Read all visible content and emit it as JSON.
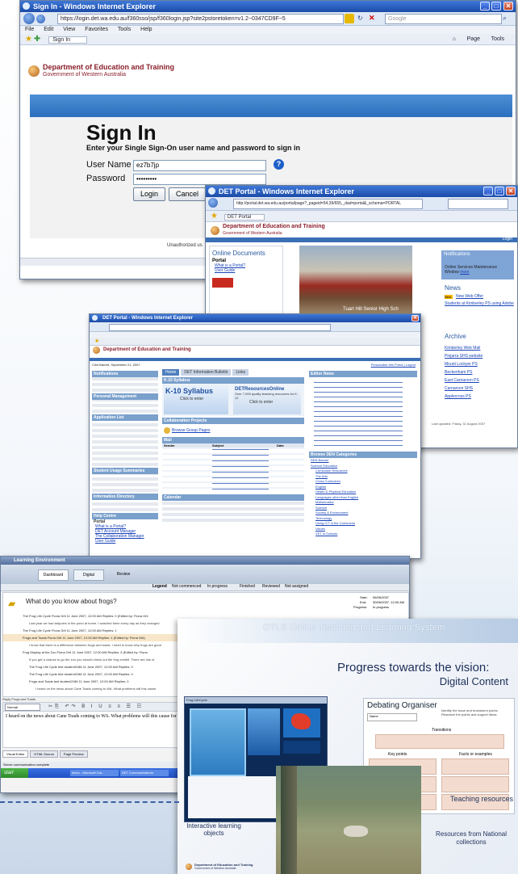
{
  "signin": {
    "title": "Sign In - Windows Internet Explorer",
    "url": "https://login.det.wa.edu.au/f360sso/jsp/f360login.jsp?site2pstoretoken=v1.2~0347CD9F~5",
    "search_placeholder": "Google",
    "menu": [
      "File",
      "Edit",
      "View",
      "Favorites",
      "Tools",
      "Help"
    ],
    "tab": "Sign In",
    "tools": [
      "Page",
      "Tools"
    ],
    "dept_line1": "Department of Education and Training",
    "dept_line2": "Government of Western Australia",
    "heading": "Sign In",
    "subheading": "Enter your Single Sign-On user name and password to sign in",
    "username_label": "User Name",
    "username_value": "ez7b7jp",
    "password_label": "Password",
    "password_value": "•••••••••",
    "login_btn": "Login",
    "cancel_btn": "Cancel",
    "footer": "Unauthorized us"
  },
  "portal": {
    "title": "DET Portal - Windows Internet Explorer",
    "url": "http://portal.det.wa.edu.au/portal/page?_pageid=54,39/655,_dad=portal&_schema=PORTAL",
    "tab": "DET Portal",
    "dept_line1": "Department of Education and Training",
    "dept_line2": "Government of Western Australia",
    "login": "Login",
    "online_docs": "Online Documents",
    "portal_label": "Portal",
    "docs": [
      "What is a Portal?",
      "User Guide"
    ],
    "photo_caption": "Tuart Hill Senior High Sch",
    "notifications": "Notifications",
    "notif_text": "Online Services Maintenance Window",
    "more": "more",
    "news": "News",
    "new_badge": "New",
    "news_item1": "New Web Offer",
    "news_item2": "Students at Kimberley PS using Adobe",
    "archive": "Archive",
    "archive_items": [
      "Kimberley Web Mail",
      "Pinjarra SHS website",
      "Mount Lockyer PS",
      "Beckenham PS",
      "East Carnarvon PS",
      "Carnarvon SHS",
      "Applecross PS"
    ],
    "updated": "Last updated: Friday, 31 August 2007"
  },
  "portal2": {
    "title": "DET Portal - Windows Internet Explorer",
    "user": "Clint Barrett, September 21, 2007",
    "personalise": "Personalise this Portal | Logout",
    "tabs": [
      "Home",
      "DET Information Bulletin",
      "Links"
    ],
    "k10_title": "K-10 Syllabus",
    "k10_logo": "K-10 Syllabus",
    "det_res_title": "DETResourcesOnline",
    "det_res_sub": "Over 7,000 quality teaching resources for K-12",
    "click": "Click to enter",
    "sections_left": [
      "Notifications",
      "Personal Management",
      "Application List",
      "Student Usage Summaries",
      "Information Directory",
      "Help Centre"
    ],
    "sections_right": [
      "Editor News",
      "Browse DEN Categories"
    ],
    "help_items": [
      "What is a Portal?",
      "DET Account Manager",
      "The Collaboration Manager",
      "User Guide"
    ],
    "collab": "Collaboration Projects",
    "mail": "Mail",
    "calendar": "Calendar",
    "mail_cols": [
      "Sender",
      "Subject",
      "Date"
    ],
    "den_items": [
      "DEN Banner",
      "Science Education",
      "Curriculum Resources",
      "The Arts",
      "Cross Curriculum",
      "English",
      "Health & Physical Education",
      "Languages other than English",
      "Mathematics",
      "Science",
      "Society & Environment",
      "Technology",
      "Using ICT in the Curriculum",
      "Values",
      "VET in Schools"
    ]
  },
  "forum": {
    "title": "Learning Environment",
    "tabs": [
      "Dashboard",
      "Digital",
      "Review"
    ],
    "legend_label": "Legend",
    "legend": [
      "Not commenced",
      "In progress",
      "Finished",
      "Reviewed",
      "Not assigned"
    ],
    "question": "What do you know about frogs?",
    "meta_labels": [
      "Start:",
      "End:",
      "Progress:"
    ],
    "meta_values": [
      "06/06/2007",
      "30/06/2007, 12:00 AM",
      "In progress"
    ],
    "posts": [
      "The Frog Life Cycle  Fiona Grit 11 June 2007, 12:00 AM  Replies: 0  (Edited by: Fiona Grit",
      "Last year we had tadpoles in the pond at home. I watched them every day as they changed",
      "The Frog Life Cycle  Fiona Grit 11 June 2007, 12:00 AM  Replies: 1",
      "Frogs and Toads  Fiona Grit 11 June 2007, 12:00 AM  Replies: 1 (Edited by: Fiona Grit)",
      "I know that there is a difference between frogs and toads. I need to know why frogs are good",
      "Frog Display at the Zoo  Fiona Grit 11 June 2007, 12:00 AM  Replies: 3 (Edited by: Fiona",
      "If you get a chance to go the zoo you should check out the frog exhibit. There are lots of",
      "The Frog Life Cycle  test student2186 11 June 2007, 12:00 AM  Replies: 0",
      "The Frog Life Cycle  test student2186 11 June 2007, 12:00 AM  Replies: 0",
      "Frogs and Toads  test student2186 11 June 2007, 12:00 AM  Replies: 0"
    ],
    "post_footer": "I heard on the news about Cane Toads coming to WA. What problems will this cause",
    "reply_label": "Reply Frogs and Toads",
    "editor_style": "Normal",
    "editor_text": "I heard on the news about Cane Toads coming to WA.  What problems will this cause for",
    "editor_tabs": [
      "Visual Editor",
      "HTML Source",
      "Page Preview"
    ],
    "statusbar": "Server communication complete",
    "taskbar": [
      "start",
      "Inbox - Microsoft Out...",
      "DET Communications"
    ]
  },
  "otls": {
    "header": "OTLS Online Teaching and Learning System",
    "title_main": "Progress towards the vision:",
    "title_sub": "Digital Content",
    "organiser_title": "Debating Organiser",
    "organiser_name": "Name",
    "organiser_desc": "Identify the issue and brainstorm points. Research the points and support ideas",
    "transitions": "Transitions",
    "key_points": "Key points",
    "facts": "Facts or examples",
    "resource_labels": [
      "Teaching resources",
      "Interactive learning objects",
      "Resources from National collections"
    ],
    "lo_title": "Frog LifeCycle",
    "lo_caption": "Interactive learning object",
    "dept_line1": "Department of Education and Training",
    "dept_line2": "Government of Western Australia"
  }
}
